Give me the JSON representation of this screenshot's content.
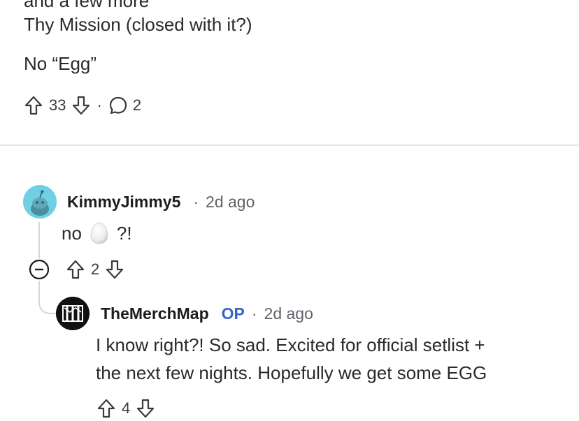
{
  "post": {
    "cut_line": "and a few more",
    "lines": [
      "Thy Mission (closed with it?)",
      "No “Egg”"
    ],
    "upvotes": "33",
    "comments": "2"
  },
  "comments": [
    {
      "author": "KimmyJimmy5",
      "time": "2d ago",
      "text_before": "no",
      "text_after": "?!",
      "votes": "2"
    },
    {
      "author": "TheMerchMap",
      "badge": "OP",
      "time": "2d ago",
      "text_lines": [
        "I know right?! So sad. Excited for official setlist +",
        "the next few nights. Hopefully we get some EGG"
      ],
      "votes": "4"
    }
  ],
  "separator": "·",
  "icons": {
    "upvote": "arrow-up-outline-icon",
    "downvote": "arrow-down-outline-icon",
    "comment": "speech-bubble-icon",
    "collapse": "minus-circle-icon",
    "egg": "egg-emoji-icon"
  },
  "colors": {
    "op_badge": "#3a64c4",
    "avatar_bg": "#6fd0e4"
  }
}
